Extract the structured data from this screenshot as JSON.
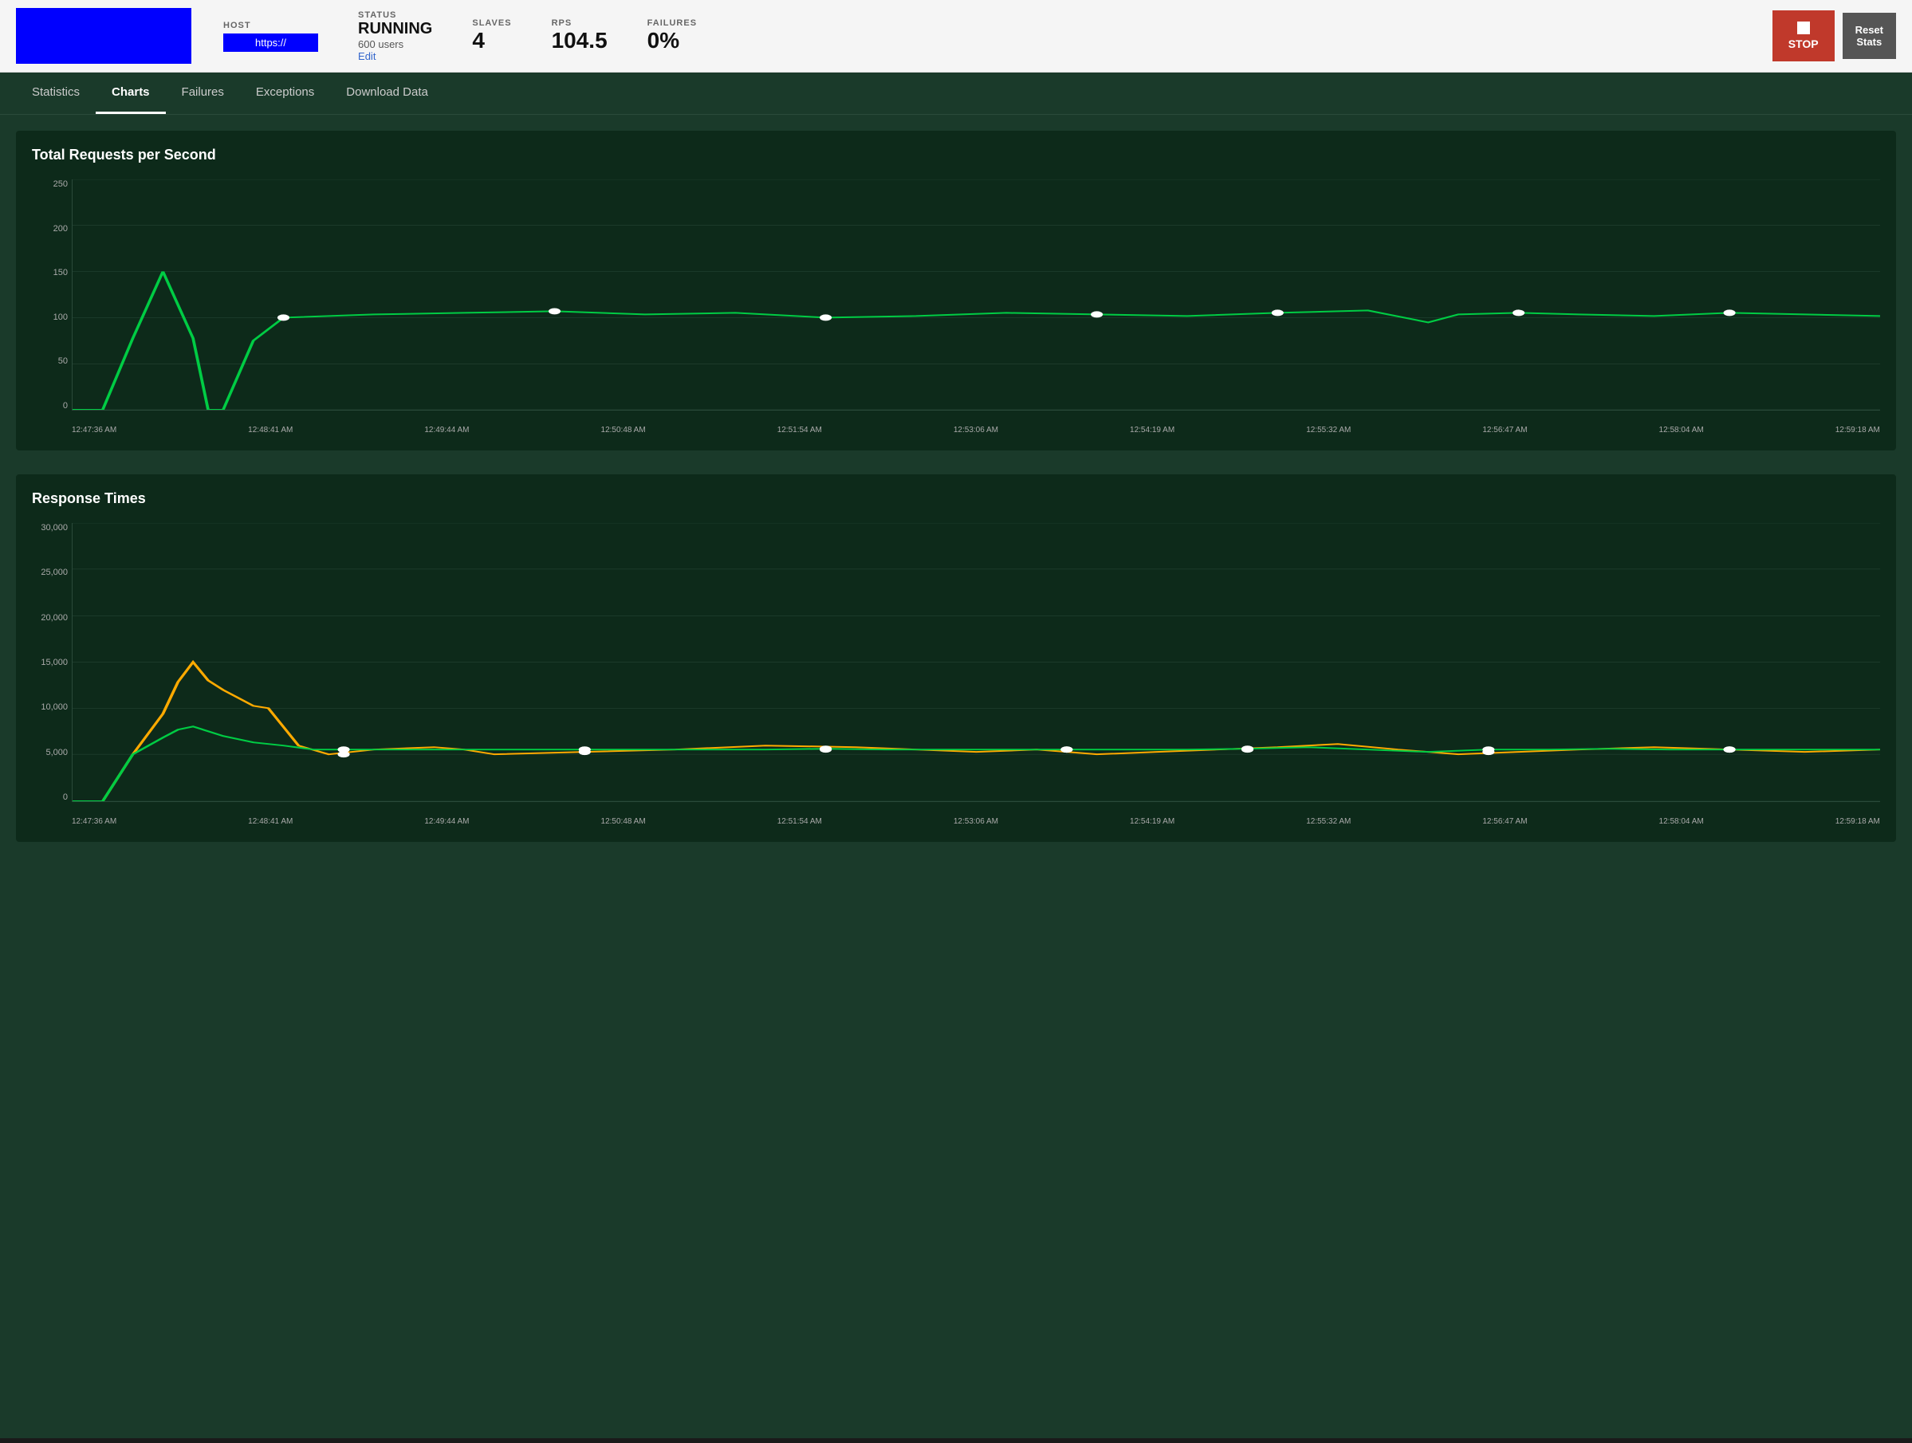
{
  "header": {
    "host_label": "HOST",
    "host_value": "https://",
    "status_label": "STATUS",
    "status_value": "RUNNING",
    "users": "600 users",
    "edit_label": "Edit",
    "slaves_label": "SLAVES",
    "slaves_value": "4",
    "rps_label": "RPS",
    "rps_value": "104.5",
    "failures_label": "FAILURES",
    "failures_value": "0%",
    "stop_label": "STOP",
    "reset_label": "Reset\nStats"
  },
  "nav": {
    "items": [
      {
        "label": "Statistics",
        "active": false
      },
      {
        "label": "Charts",
        "active": true
      },
      {
        "label": "Failures",
        "active": false
      },
      {
        "label": "Exceptions",
        "active": false
      },
      {
        "label": "Download Data",
        "active": false
      }
    ]
  },
  "charts": {
    "chart1": {
      "title": "Total Requests per Second",
      "y_labels": [
        "250",
        "200",
        "150",
        "100",
        "50",
        "0"
      ],
      "x_labels": [
        "12:47:36 AM",
        "12:48:41 AM",
        "12:49:44 AM",
        "12:50:48 AM",
        "12:51:54 AM",
        "12:53:06 AM",
        "12:54:19 AM",
        "12:55:32 AM",
        "12:56:47 AM",
        "12:58:04 AM",
        "12:59:18 AM"
      ]
    },
    "chart2": {
      "title": "Response Times",
      "y_labels": [
        "30,000",
        "25,000",
        "20,000",
        "15,000",
        "10,000",
        "5,000",
        "0"
      ],
      "x_labels": [
        "12:47:36 AM",
        "12:48:41 AM",
        "12:49:44 AM",
        "12:50:48 AM",
        "12:51:54 AM",
        "12:53:06 AM",
        "12:54:19 AM",
        "12:55:32 AM",
        "12:56:47 AM",
        "12:58:04 AM",
        "12:59:18 AM"
      ]
    }
  }
}
